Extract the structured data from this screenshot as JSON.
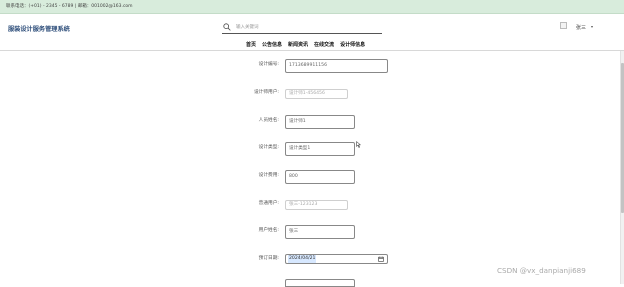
{
  "topbar": {
    "contact": "联系电话：(+01) - 2345 - 6789 | 邮箱：001002@163.com"
  },
  "header": {
    "brand": "服装设计服务管理系统",
    "search": {
      "placeholder": "输入关键词",
      "icon": "search-icon"
    },
    "nav": [
      "首页",
      "公告信息",
      "新闻资讯",
      "在线交流",
      "设计师信息"
    ],
    "user": {
      "name": "张三",
      "icon": "avatar"
    }
  },
  "form": {
    "rows": [
      {
        "label": "设计编号:",
        "value": "1713689911156",
        "kind": "wide"
      },
      {
        "label": "设计师用户:",
        "value": "设计师1-456456",
        "kind": "readonly"
      },
      {
        "label": "人员姓名:",
        "value": "设计师1",
        "kind": "medium"
      },
      {
        "label": "设计类型:",
        "value": "设计类型1",
        "kind": "medium"
      },
      {
        "label": "设计费用:",
        "value": "800",
        "kind": "medium"
      },
      {
        "label": "普通用户:",
        "value": "张三-123123",
        "kind": "readonly"
      },
      {
        "label": "用户姓名:",
        "value": "张三",
        "kind": "medium"
      },
      {
        "label": "预订日期:",
        "value": "2024/04/21",
        "kind": "date"
      }
    ]
  },
  "watermark": "CSDN @vx_danpianji689",
  "colors": {
    "topbar": "#d8ecdc",
    "brand": "#2f4f7b",
    "date_highlight": "#d7e8ff"
  }
}
